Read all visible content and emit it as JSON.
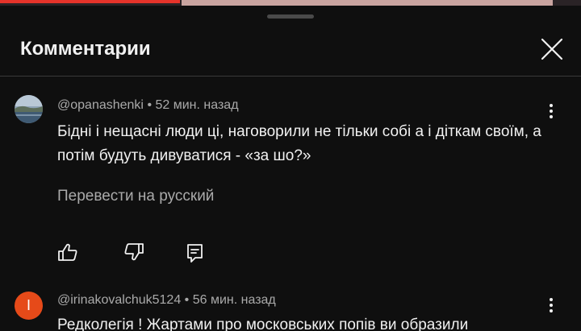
{
  "header": {
    "title": "Комментарии"
  },
  "video_progress": 0.31,
  "comments": [
    {
      "author": "@opanashenki",
      "age": "52 мин. назад",
      "text": "Бідні і нещасні люди ці, наговорили не тільки собі а і діткам своїм, а потім будуть дивуватися - «за шо?»",
      "translate_label": "Перевести на русский"
    },
    {
      "author": "@irinakovalchuk5124",
      "age": "56 мин. назад",
      "avatar_letter": "I",
      "text": "Редколегія ! Жартами про московських попів ви образили"
    }
  ],
  "separator": "•",
  "icons": {
    "close": "close-icon",
    "more": "more-vert-icon",
    "like": "thumb-up-icon",
    "dislike": "thumb-down-icon",
    "reply": "reply-icon"
  },
  "colors": {
    "background": "#0f0f0f",
    "accent": "#e6332a",
    "avatar_orange": "#e64a19",
    "secondary_text": "#aaaaaa"
  }
}
